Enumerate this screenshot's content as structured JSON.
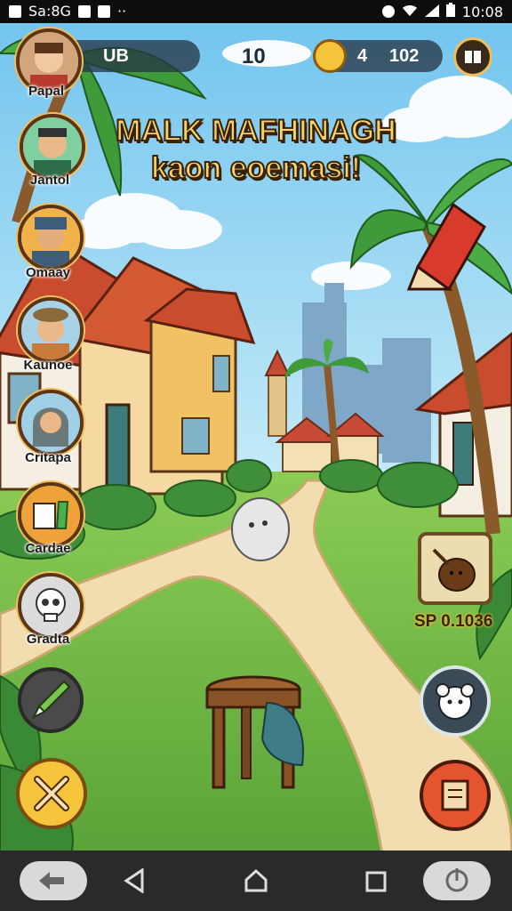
{
  "status_bar": {
    "time_left": "Sa:8G",
    "time_right": "10:08"
  },
  "hud": {
    "player_value": "UB",
    "level": "10",
    "coins_small": "4",
    "coins": "102"
  },
  "title": {
    "line1": "MALK MAFHINAGH",
    "line2": "kaon eoemasi!"
  },
  "characters": [
    {
      "label": "Papal",
      "icon": "person-portrait-icon"
    },
    {
      "label": "Jantol",
      "icon": "person-portrait-icon"
    },
    {
      "label": "Omaay",
      "icon": "person-portrait-icon"
    },
    {
      "label": "Kaunoe",
      "icon": "person-portrait-icon"
    },
    {
      "label": "Critapa",
      "icon": "person-portrait-icon"
    },
    {
      "label": "Cardae",
      "icon": "book-icon"
    },
    {
      "label": "Gradta",
      "icon": "skull-icon"
    }
  ],
  "right_panel": {
    "item_label": "SP 0.1036"
  },
  "colors": {
    "accent_gold": "#f3d46a",
    "sky": "#8fd0f0",
    "grass": "#74c04a",
    "path": "#f2ddb0"
  }
}
